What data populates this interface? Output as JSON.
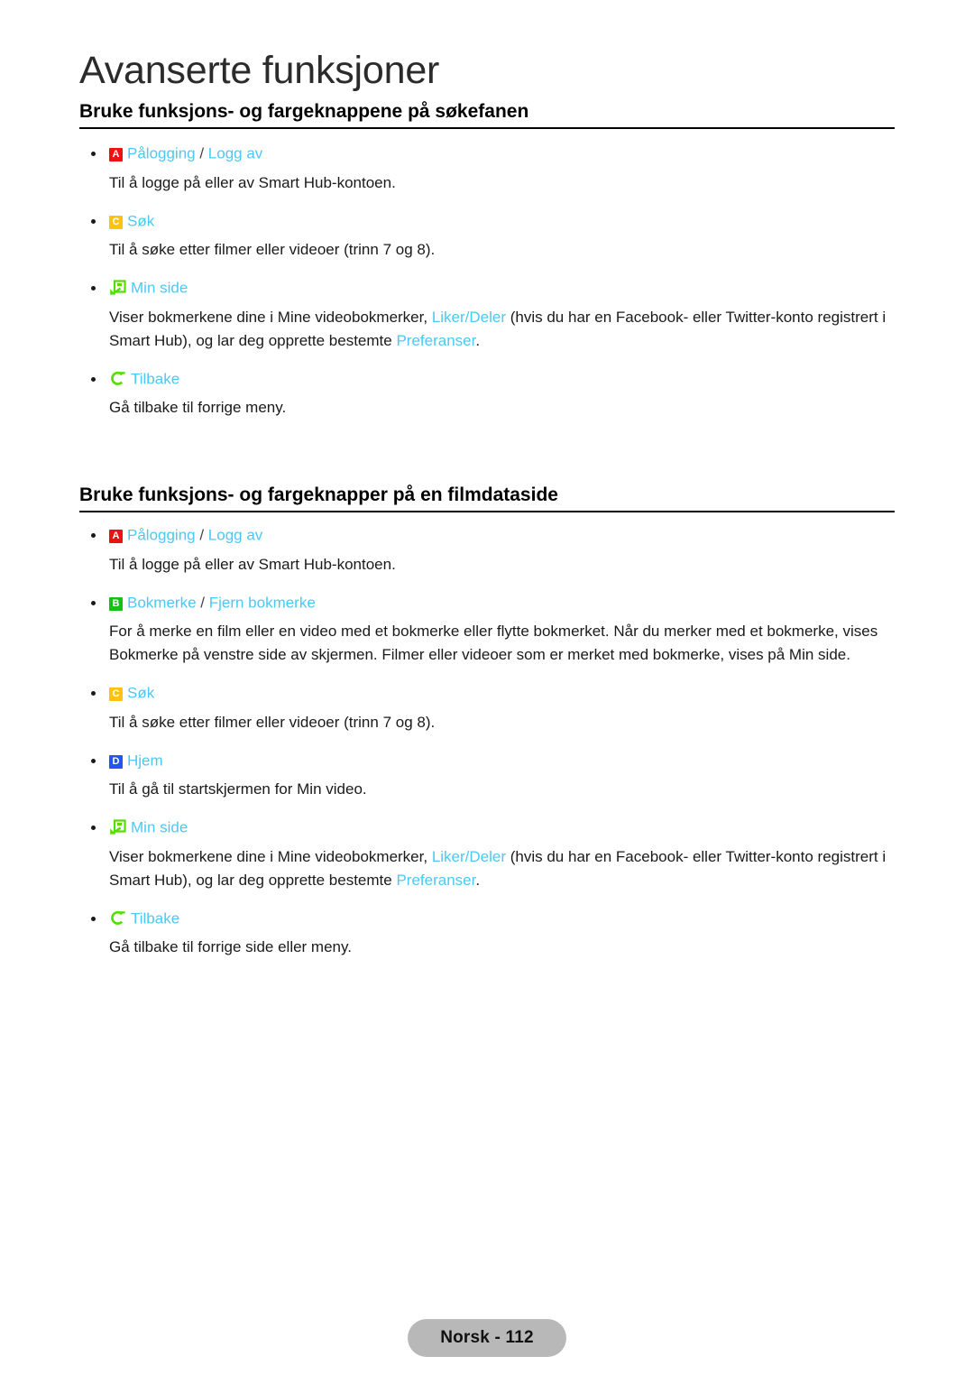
{
  "page": {
    "chapter_title": "Avanserte funksjoner",
    "footer_label": "Norsk - 112",
    "colors": {
      "link": "#4bc8f5",
      "key_a": "#ee1111",
      "key_b": "#17c017",
      "key_c": "#ffc20e",
      "key_d": "#2255ee",
      "icon_green": "#55dd00",
      "footer_pill": "#b8b8b8"
    }
  },
  "sections": [
    {
      "heading": "Bruke funksjons- og fargeknappene på søkefanen",
      "items": [
        {
          "badge": "A",
          "badge_color": "key-a",
          "label_primary": "Pålogging",
          "separator": " / ",
          "label_secondary": "Logg av",
          "description": "Til å logge på eller av Smart Hub-kontoen."
        },
        {
          "badge": "C",
          "badge_color": "key-c",
          "label_primary": "Søk",
          "description": "Til å søke etter filmer eller videoer (trinn 7 og 8)."
        },
        {
          "icon": "my-page-icon",
          "label_primary": "Min side",
          "description_parts": [
            {
              "text": "Viser bokmerkene dine i Mine videobokmerker, ",
              "highlight": false
            },
            {
              "text": "Liker/Deler",
              "highlight": true
            },
            {
              "text": " (hvis du har en Facebook- eller Twitter-konto registrert i Smart Hub), og lar deg opprette bestemte ",
              "highlight": false
            },
            {
              "text": "Preferanser",
              "highlight": true
            },
            {
              "text": ".",
              "highlight": false
            }
          ]
        },
        {
          "icon": "return-icon",
          "label_primary": "Tilbake",
          "description": "Gå tilbake til forrige meny."
        }
      ]
    },
    {
      "heading": "Bruke funksjons- og fargeknapper på en filmdataside",
      "items": [
        {
          "badge": "A",
          "badge_color": "key-a",
          "label_primary": "Pålogging",
          "separator": " / ",
          "label_secondary": "Logg av",
          "description": "Til å logge på eller av Smart Hub-kontoen."
        },
        {
          "badge": "B",
          "badge_color": "key-b",
          "label_primary": "Bokmerke",
          "separator": " / ",
          "label_secondary": "Fjern bokmerke",
          "description": "For å merke en film eller en video med et bokmerke eller flytte bokmerket. Når du merker med et bokmerke, vises Bokmerke på venstre side av skjermen. Filmer eller videoer som er merket med bokmerke, vises på Min side."
        },
        {
          "badge": "C",
          "badge_color": "key-c",
          "label_primary": "Søk",
          "description": "Til å søke etter filmer eller videoer (trinn 7 og 8)."
        },
        {
          "badge": "D",
          "badge_color": "key-d",
          "label_primary": "Hjem",
          "description": "Til å gå til startskjermen for Min video."
        },
        {
          "icon": "my-page-icon",
          "label_primary": "Min side",
          "description_parts": [
            {
              "text": "Viser bokmerkene dine i Mine videobokmerker, ",
              "highlight": false
            },
            {
              "text": "Liker/Deler",
              "highlight": true
            },
            {
              "text": " (hvis du har en Facebook- eller Twitter-konto registrert i Smart Hub), og lar deg opprette bestemte ",
              "highlight": false
            },
            {
              "text": "Preferanser",
              "highlight": true
            },
            {
              "text": ".",
              "highlight": false
            }
          ]
        },
        {
          "icon": "return-icon",
          "label_primary": "Tilbake",
          "description": "Gå tilbake til forrige side eller meny."
        }
      ]
    }
  ]
}
